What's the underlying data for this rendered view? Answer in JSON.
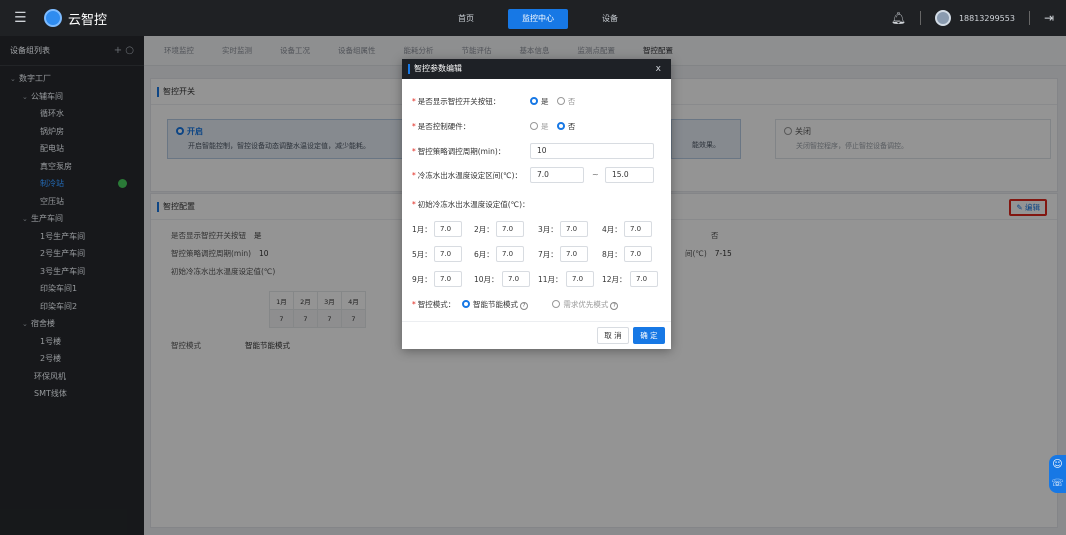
{
  "header": {
    "brand": "云智控",
    "nav": [
      {
        "label": "首页",
        "active": false
      },
      {
        "label": "监控中心",
        "active": true
      },
      {
        "label": "设备",
        "active": false
      }
    ],
    "user_phone": "18813299553"
  },
  "sidebar": {
    "title": "设备组列表",
    "tree": [
      {
        "label": "数字工厂",
        "level": "l0",
        "caret": "v"
      },
      {
        "label": "公辅车间",
        "level": "l1",
        "caret": "v"
      },
      {
        "label": "循环水",
        "level": "l2"
      },
      {
        "label": "锅炉房",
        "level": "l2"
      },
      {
        "label": "配电站",
        "level": "l2"
      },
      {
        "label": "真空泵房",
        "level": "l2"
      },
      {
        "label": "制冷站",
        "level": "l2",
        "active": true,
        "status": "online"
      },
      {
        "label": "空压站",
        "level": "l2"
      },
      {
        "label": "生产车间",
        "level": "l1",
        "caret": "v"
      },
      {
        "label": "1号生产车间",
        "level": "l2"
      },
      {
        "label": "2号生产车间",
        "level": "l2"
      },
      {
        "label": "3号生产车间",
        "level": "l2"
      },
      {
        "label": "印染车间1",
        "level": "l2"
      },
      {
        "label": "印染车间2",
        "level": "l2"
      },
      {
        "label": "宿舍楼",
        "level": "l1",
        "caret": "v"
      },
      {
        "label": "1号楼",
        "level": "l2"
      },
      {
        "label": "2号楼",
        "level": "l2"
      },
      {
        "label": "环保风机",
        "level": "root"
      },
      {
        "label": "SMT线体",
        "level": "root"
      }
    ]
  },
  "tabs": [
    "环境监控",
    "实时监测",
    "设备工况",
    "设备组属性",
    "能耗分析",
    "节能评估",
    "基本信息",
    "监测点配置",
    "智控配置"
  ],
  "active_tab": "智控配置",
  "switch_panel": {
    "title": "智控开关",
    "on_mode": {
      "name": "开启",
      "desc": "开启智能控制，智控设备动态调整水温设定值，减少能耗。"
    },
    "off_mode": {
      "name": "关闭",
      "desc": "关闭智控程序，停止智控设备调控。"
    },
    "partial_desc": "能效果。"
  },
  "config_panel": {
    "title": "智控配置",
    "edit_label": "编辑",
    "show_button_label": "是否显示智控开关按钮",
    "show_button_value": "是",
    "cycle_label": "智控策略调控周期(min)",
    "cycle_value": "10",
    "init_temp_label": "初始冷冻水出水温度设定值(℃)",
    "months": [
      "1月",
      "2月",
      "3月",
      "4月"
    ],
    "month_values": [
      "7",
      "7",
      "7",
      "7"
    ],
    "mode_label": "智控模式",
    "mode_value": "智能节能模式",
    "right_value1": "否",
    "right_label2_tail": "间(℃)",
    "right_value2": "7-15"
  },
  "dialog": {
    "title": "智控参数编辑",
    "close": "x",
    "show_switch": {
      "label": "是否显示智控开关按钮：",
      "yes": "是",
      "no": "否",
      "selected": "是"
    },
    "control_hw": {
      "label": "是否控制硬件：",
      "yes": "是",
      "no": "否",
      "selected": "否"
    },
    "cycle": {
      "label": "智控策略调控周期(min)：",
      "value": "10"
    },
    "temp_range": {
      "label": "冷冻水出水温度设定区间(℃)：",
      "min": "7.0",
      "max": "15.0",
      "sep": "~"
    },
    "init_temp": {
      "label": "初始冷冻水出水温度设定值(℃)："
    },
    "months": [
      {
        "label": "1月：",
        "value": "7.0"
      },
      {
        "label": "2月：",
        "value": "7.0"
      },
      {
        "label": "3月：",
        "value": "7.0"
      },
      {
        "label": "4月：",
        "value": "7.0"
      },
      {
        "label": "5月：",
        "value": "7.0"
      },
      {
        "label": "6月：",
        "value": "7.0"
      },
      {
        "label": "7月：",
        "value": "7.0"
      },
      {
        "label": "8月：",
        "value": "7.0"
      },
      {
        "label": "9月：",
        "value": "7.0"
      },
      {
        "label": "10月：",
        "value": "7.0"
      },
      {
        "label": "11月：",
        "value": "7.0"
      },
      {
        "label": "12月：",
        "value": "7.0"
      }
    ],
    "mode": {
      "label": "智控模式：",
      "option1": "智能节能模式",
      "option2": "需求优先模式",
      "selected": "智能节能模式"
    },
    "cancel": "取 消",
    "ok": "确 定"
  },
  "icons": {
    "menu": "menu-icon",
    "bell": "bell-icon",
    "logout": "logout-icon",
    "chat": "chat-icon",
    "phone": "phone-icon"
  },
  "colors": {
    "primary": "#1778e5",
    "dark": "#1f2124",
    "highlight_border": "#e0261c",
    "online": "#39a34a"
  }
}
